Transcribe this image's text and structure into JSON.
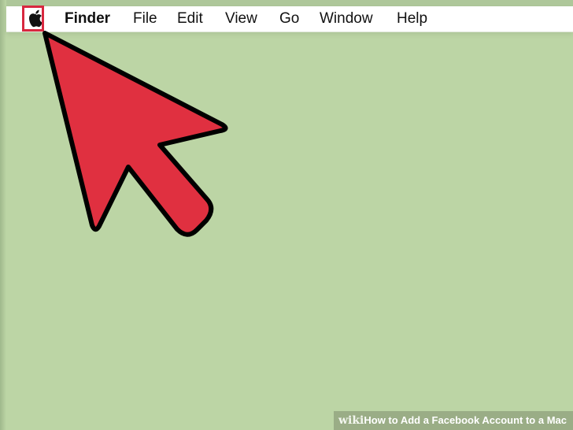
{
  "menubar": {
    "apple_icon": "apple-logo-icon",
    "app_name": "Finder",
    "items": [
      {
        "label": "File"
      },
      {
        "label": "Edit"
      },
      {
        "label": "View"
      },
      {
        "label": "Go"
      },
      {
        "label": "Window"
      },
      {
        "label": "Help"
      }
    ]
  },
  "annotation": {
    "arrow_icon": "red-arrow-pointer-icon",
    "arrow_color": "#e03040",
    "highlight_color": "#d8283f"
  },
  "watermark": {
    "wiki": "wiki",
    "how": "How",
    "rest": " to Add a Facebook Account to a Mac"
  },
  "colors": {
    "desktop": "#bcd5a5",
    "menubar": "#ffffff"
  }
}
